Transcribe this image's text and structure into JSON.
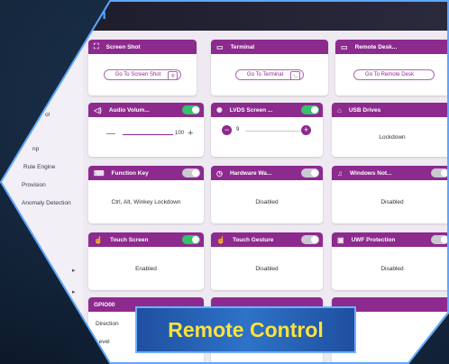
{
  "app": {
    "logo_text": "m"
  },
  "sidebar": {
    "items": [
      {
        "label": "ol"
      },
      {
        "label": "np"
      },
      {
        "label": "Rule Engine"
      },
      {
        "label": "Provision"
      },
      {
        "label": "Anomaly Detection"
      }
    ]
  },
  "cards": {
    "screen_shot": {
      "title": "Screen Shot",
      "button": "Go To Screen Shot"
    },
    "terminal": {
      "title": "Terminal",
      "button": "Go To Terminal"
    },
    "remote_desktop": {
      "title": "Remote Desk...",
      "button": "Go To Remote Desk"
    },
    "audio_volume": {
      "title": "Audio Volum...",
      "value": "100",
      "toggle": true,
      "level": 1.0
    },
    "lvds_screen": {
      "title": "LVDS Screen ...",
      "value": "9",
      "toggle": true
    },
    "usb_drives": {
      "title": "USB Drives",
      "status": "Lockdown"
    },
    "function_key": {
      "title": "Function Key",
      "status": "Ctrl, Alt, Winkey Lockdown",
      "toggle": false
    },
    "hardware_watchdog": {
      "title": "Hardware Wa...",
      "status": "Disabled",
      "toggle": false
    },
    "windows_notifications": {
      "title": "Windows Not...",
      "status": "Disabled",
      "toggle": false
    },
    "touch_screen": {
      "title": "Touch Screen",
      "status": "Enabled",
      "toggle": true
    },
    "touch_gesture": {
      "title": "Touch Gesture",
      "status": "Disabled",
      "toggle": false
    },
    "uwf_protection": {
      "title": "UWF Protection",
      "status": "Disabled",
      "toggle": false
    },
    "gpio": {
      "title": "GPIO00",
      "field1": "Direction",
      "field2": "Level"
    }
  },
  "banner": {
    "text": "Remote Control"
  },
  "colors": {
    "header_purple": "#8d2a8e",
    "toggle_on": "#34c36a",
    "banner_text": "#ffe23a"
  }
}
